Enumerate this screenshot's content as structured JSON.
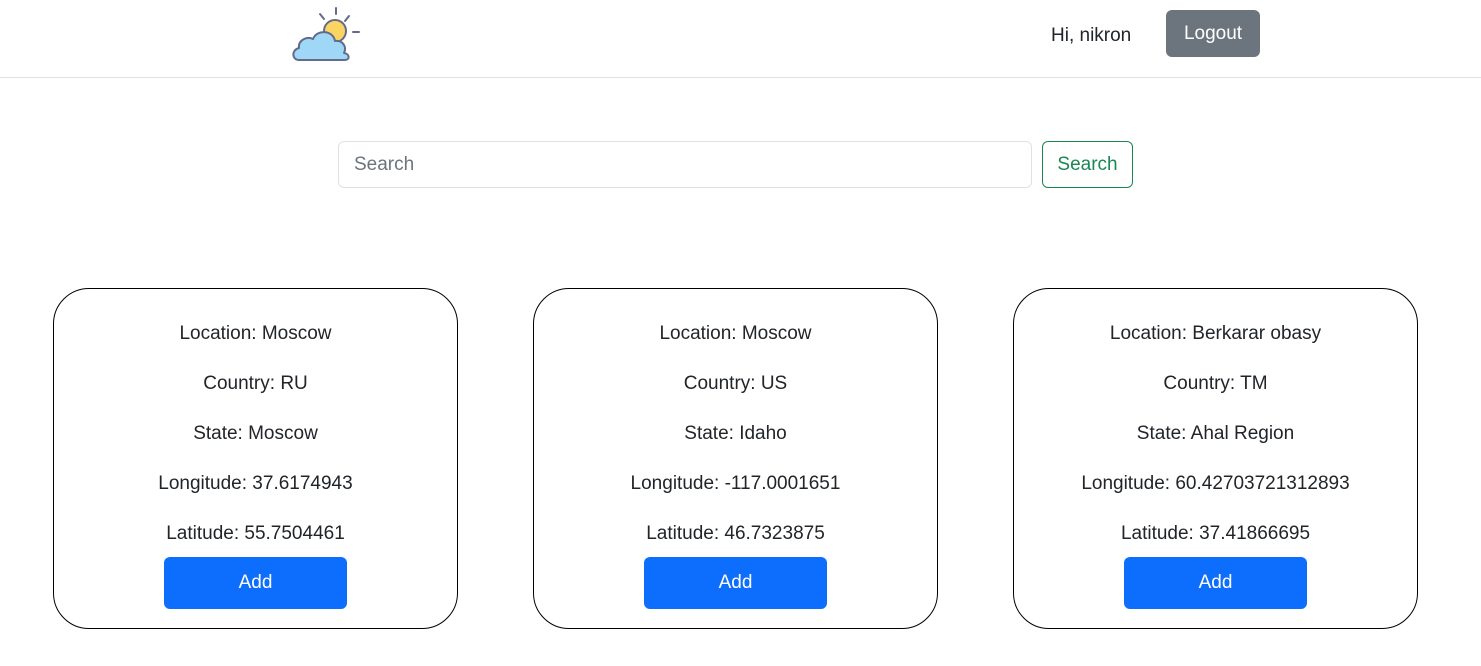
{
  "navbar": {
    "logo_icon": "cloud-sun-icon",
    "greeting": "Hi, nikron",
    "logout_label": "Logout"
  },
  "search": {
    "placeholder": "Search",
    "value": "",
    "button_label": "Search"
  },
  "cards": [
    {
      "location": "Location: Moscow",
      "country": "Country: RU",
      "state": "State: Moscow",
      "longitude": "Longitude: 37.6174943",
      "latitude": "Latitude: 55.7504461",
      "add_label": "Add"
    },
    {
      "location": "Location: Moscow",
      "country": "Country: US",
      "state": "State: Idaho",
      "longitude": "Longitude: -117.0001651",
      "latitude": "Latitude: 46.7323875",
      "add_label": "Add"
    },
    {
      "location": "Location: Berkarar obasy",
      "country": "Country: TM",
      "state": "State: Ahal Region",
      "longitude": "Longitude: 60.42703721312893",
      "latitude": "Latitude: 37.41866695",
      "add_label": "Add"
    }
  ],
  "colors": {
    "primary": "#0d6efd",
    "secondary": "#6c757d",
    "success": "#198754",
    "sun": "#fcd462",
    "cloud": "#9fd7f6",
    "cloud_outline": "#646a8a"
  }
}
